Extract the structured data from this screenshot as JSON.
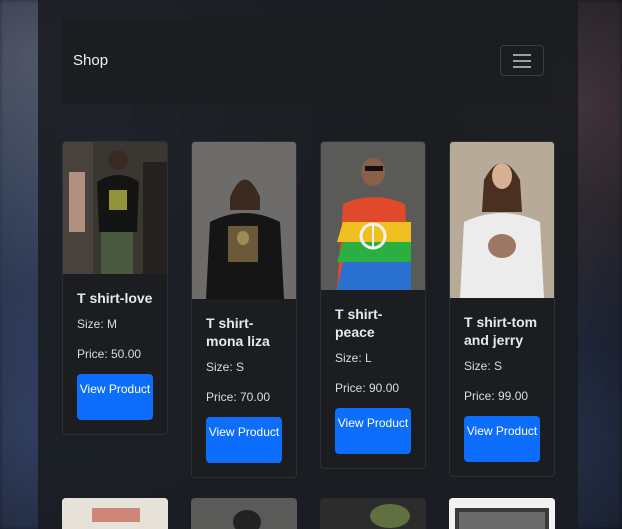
{
  "navbar": {
    "brand": "Shop",
    "toggler_icon": "hamburger-menu-icon"
  },
  "products": [
    {
      "title": "T shirt-love",
      "size": "Size: M",
      "price": "Price: 50.00",
      "button": "View Product"
    },
    {
      "title": "T shirt-mona liza",
      "size": "Size: S",
      "price": "Price: 70.00",
      "button": "View Product"
    },
    {
      "title": "T shirt-peace",
      "size": "Size: L",
      "price": "Price: 90.00",
      "button": "View Product"
    },
    {
      "title": "T shirt-tom and jerry",
      "size": "Size: S",
      "price": "Price: 99.00",
      "button": "View Product"
    }
  ],
  "colors": {
    "accent": "#0d6efd",
    "card_bg": "#1b1d21",
    "page_bg": "#191b1f"
  }
}
